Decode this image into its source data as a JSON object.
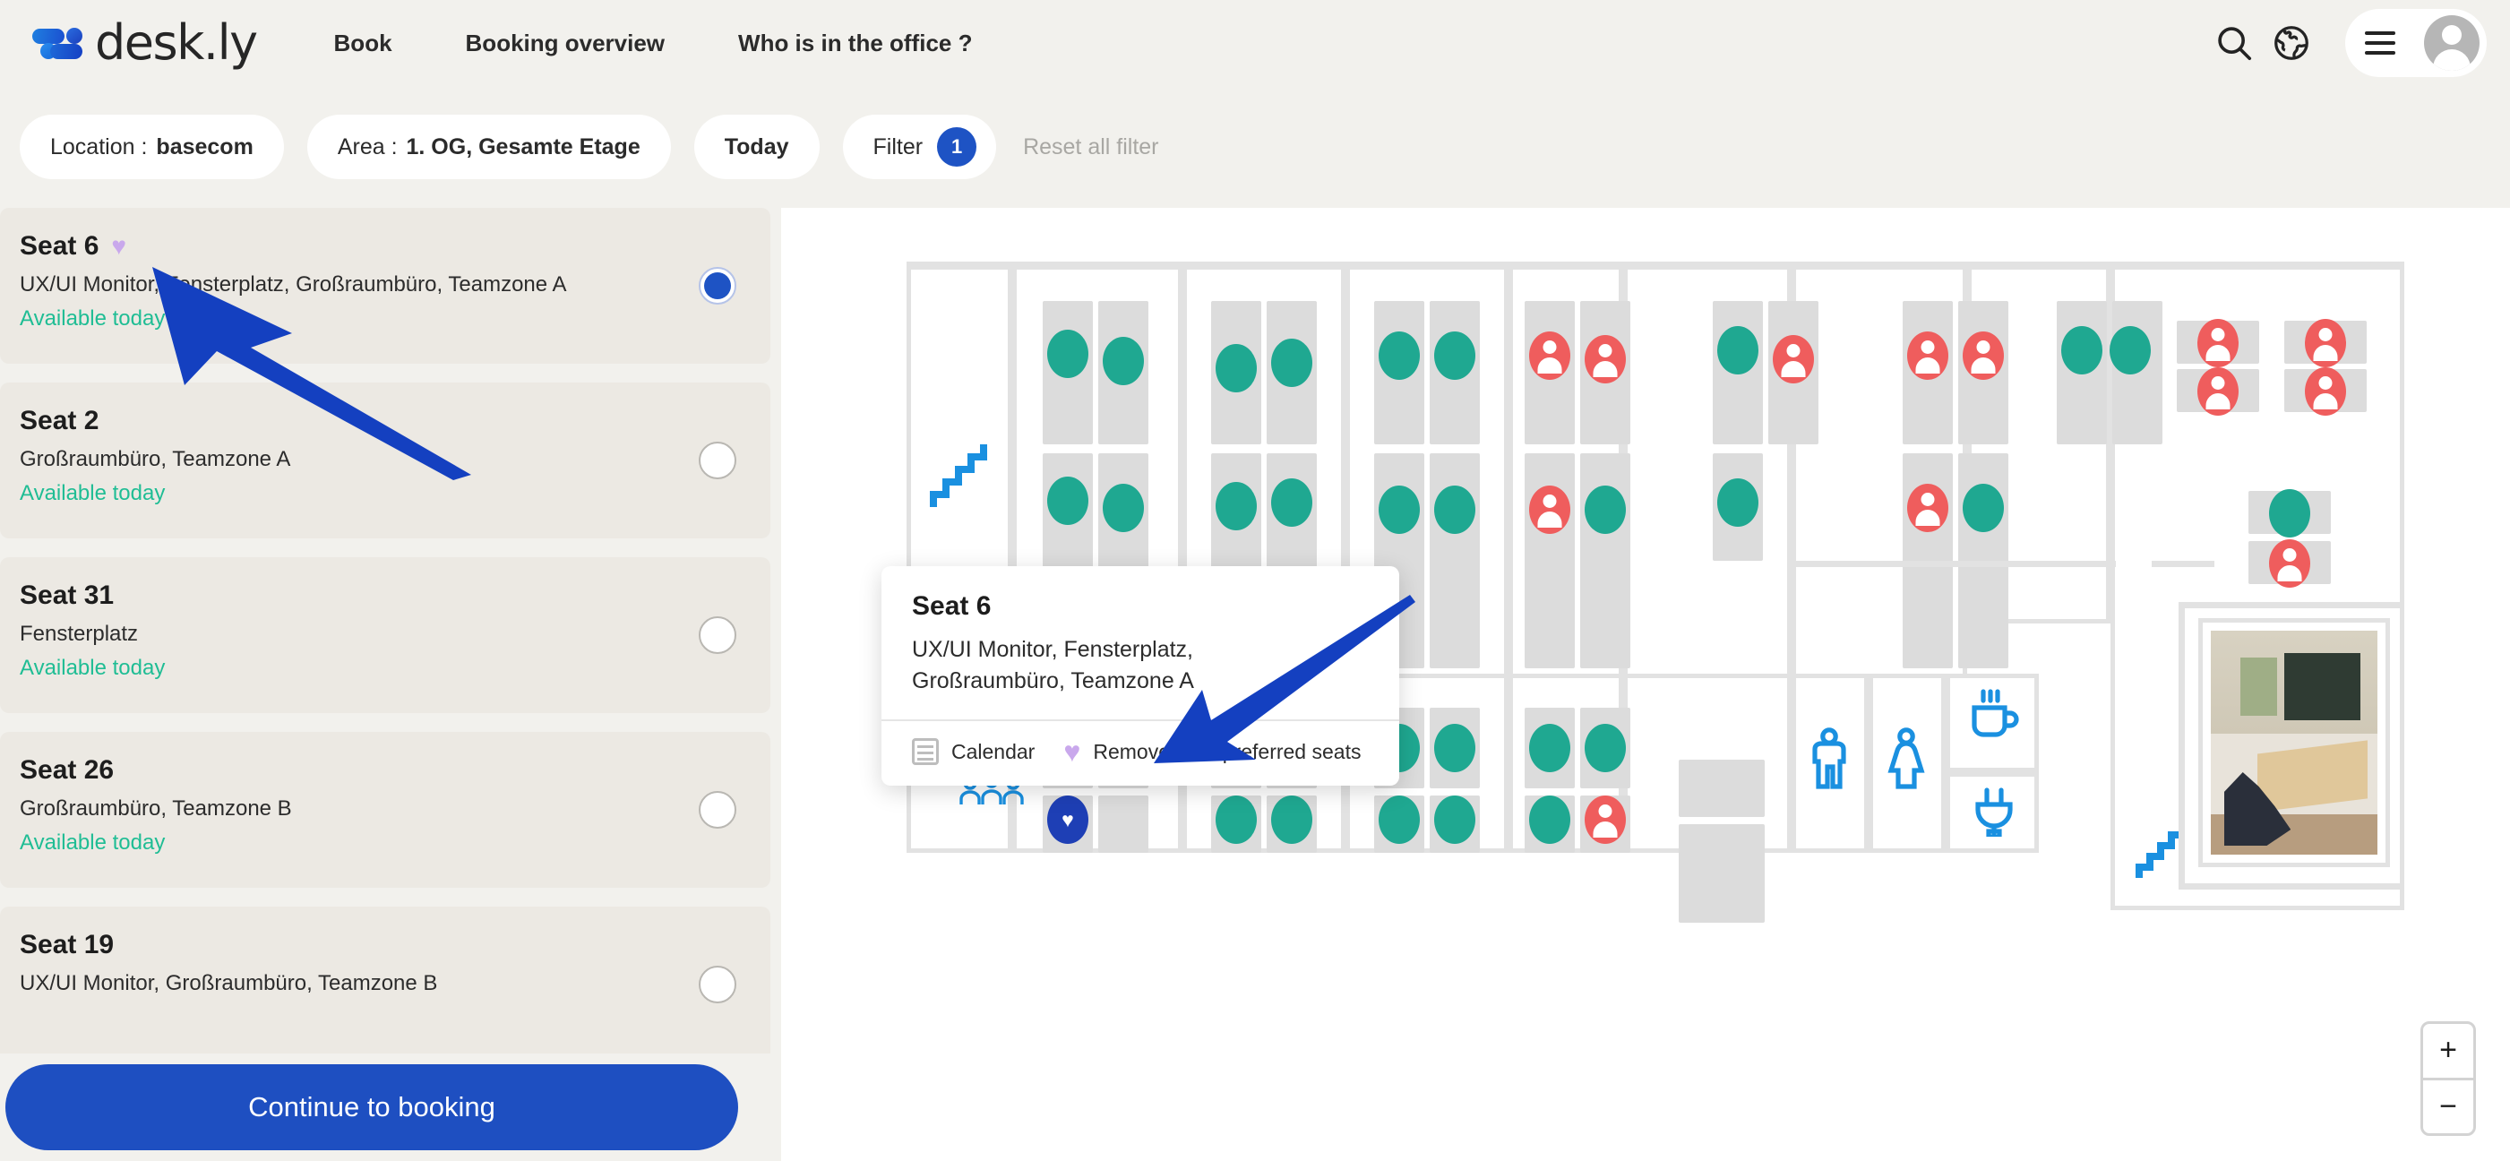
{
  "brand": {
    "word": "desk.ly",
    "logo_icon": "desk-ly-logo"
  },
  "nav": {
    "links": [
      {
        "label": "Book"
      },
      {
        "label": "Booking overview"
      },
      {
        "label": "Who is in the office ?"
      }
    ],
    "search_icon": "search-icon",
    "language_icon": "globe-icon",
    "menu_icon": "hamburger-menu-icon",
    "avatar_icon": "user-avatar"
  },
  "filters": {
    "location": {
      "label": "Location :",
      "value": "basecom"
    },
    "area": {
      "label": "Area :",
      "value": "1. OG, Gesamte Etage"
    },
    "today": {
      "label": "Today"
    },
    "filter": {
      "label": "Filter",
      "count": "1"
    },
    "reset": {
      "label": "Reset all filter"
    }
  },
  "seats": [
    {
      "name": "Seat 6",
      "favorite": true,
      "heart": "♥",
      "desc": "UX/UI Monitor, Fensterplatz, Großraumbüro, Teamzone A",
      "status": "Available today",
      "selected": true
    },
    {
      "name": "Seat 2",
      "favorite": false,
      "heart": "",
      "desc": "Großraumbüro, Teamzone A",
      "status": "Available today",
      "selected": false
    },
    {
      "name": "Seat 31",
      "favorite": false,
      "heart": "",
      "desc": "Fensterplatz",
      "status": "Available today",
      "selected": false
    },
    {
      "name": "Seat 26",
      "favorite": false,
      "heart": "",
      "desc": "Großraumbüro, Teamzone B",
      "status": "Available today",
      "selected": false
    },
    {
      "name": "Seat 19",
      "favorite": false,
      "heart": "",
      "desc": "UX/UI Monitor, Großraumbüro, Teamzone B",
      "status": "",
      "selected": false
    }
  ],
  "cta": {
    "label": "Continue to booking"
  },
  "tooltip": {
    "title": "Seat 6",
    "desc_line1": "UX/UI Monitor, Fensterplatz,",
    "desc_line2": "Großraumbüro, Teamzone A",
    "calendar_label": "Calendar",
    "calendar_icon": "calendar-icon",
    "favorite_label": "Remove from preferred seats",
    "favorite_icon": "heart-icon",
    "heart": "♥"
  },
  "map": {
    "zoom_in": "+",
    "zoom_out": "−",
    "icons": {
      "stairs": "stairs-icon",
      "toilet_men": "toilet-men-icon",
      "toilet_women": "toilet-women-icon",
      "coffee": "coffee-icon",
      "power": "power-plug-icon",
      "meeting": "meeting-people-icon",
      "photo": "meeting-room-photo"
    },
    "selected_seat_heart": "♥"
  },
  "colors": {
    "accent_blue": "#1e53c4",
    "available_teal": "#1fa891",
    "occupied_red": "#ef5d5d",
    "favorite_purple": "#c9a8ec",
    "status_green": "#1fbd94",
    "page_bg": "#f2f1ed",
    "card_bg": "#ece9e3",
    "annotation_blue": "#1440c0"
  },
  "annotations": [
    {
      "name": "arrow-to-seat-6-heart"
    },
    {
      "name": "arrow-to-remove-preferred"
    }
  ]
}
